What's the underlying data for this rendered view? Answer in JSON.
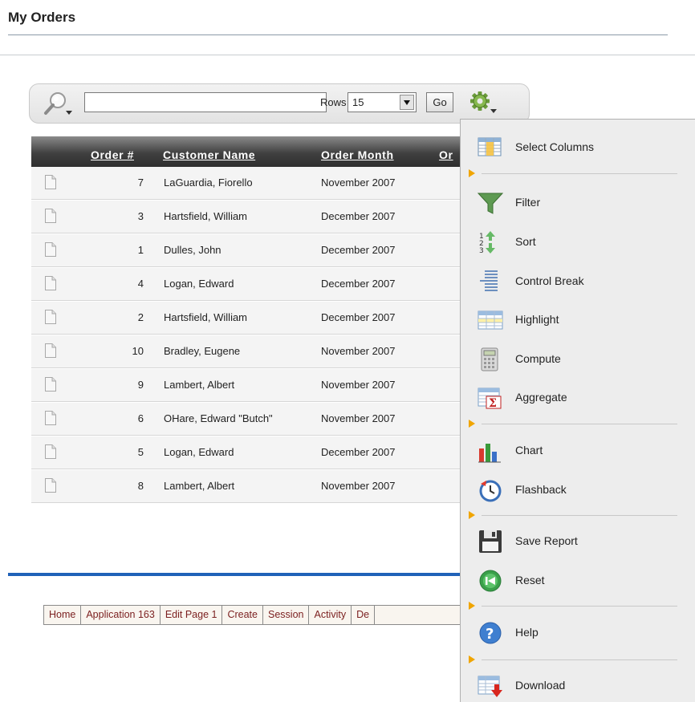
{
  "page": {
    "title": "My Orders"
  },
  "search": {
    "value": "",
    "rows_label": "Rows",
    "rows_value": "15",
    "go_label": "Go"
  },
  "report": {
    "columns": [
      "Order #",
      "Customer Name",
      "Order Month",
      "Or"
    ],
    "rows": [
      {
        "order": "7",
        "customer": "LaGuardia, Fiorello",
        "month": "November 2007"
      },
      {
        "order": "3",
        "customer": "Hartsfield, William",
        "month": "December 2007"
      },
      {
        "order": "1",
        "customer": "Dulles, John",
        "month": "December 2007"
      },
      {
        "order": "4",
        "customer": "Logan, Edward",
        "month": "December 2007"
      },
      {
        "order": "2",
        "customer": "Hartsfield, William",
        "month": "December 2007"
      },
      {
        "order": "10",
        "customer": "Bradley, Eugene",
        "month": "November 2007"
      },
      {
        "order": "9",
        "customer": "Lambert, Albert",
        "month": "November 2007"
      },
      {
        "order": "6",
        "customer": "OHare, Edward \"Butch\"",
        "month": "November 2007"
      },
      {
        "order": "5",
        "customer": "Logan, Edward",
        "month": "December 2007"
      },
      {
        "order": "8",
        "customer": "Lambert, Albert",
        "month": "November 2007"
      }
    ]
  },
  "menu": {
    "items": [
      {
        "label": "Select Columns",
        "icon": "select-columns-icon"
      },
      {
        "label": "Filter",
        "icon": "filter-icon"
      },
      {
        "label": "Sort",
        "icon": "sort-icon"
      },
      {
        "label": "Control Break",
        "icon": "control-break-icon"
      },
      {
        "label": "Highlight",
        "icon": "highlight-icon"
      },
      {
        "label": "Compute",
        "icon": "compute-icon"
      },
      {
        "label": "Aggregate",
        "icon": "aggregate-icon"
      },
      {
        "label": "Chart",
        "icon": "chart-icon"
      },
      {
        "label": "Flashback",
        "icon": "flashback-icon"
      },
      {
        "label": "Save Report",
        "icon": "save-icon"
      },
      {
        "label": "Reset",
        "icon": "reset-icon"
      },
      {
        "label": "Help",
        "icon": "help-icon"
      },
      {
        "label": "Download",
        "icon": "download-icon"
      }
    ]
  },
  "dev_toolbar": {
    "links": [
      "Home",
      "Application 163",
      "Edit Page 1",
      "Create",
      "Session",
      "Activity",
      "De"
    ]
  },
  "colors": {
    "footer_rule": "#2062b8",
    "menu_separator_arrow": "#f0a500",
    "dev_link": "#7b1f1f"
  }
}
